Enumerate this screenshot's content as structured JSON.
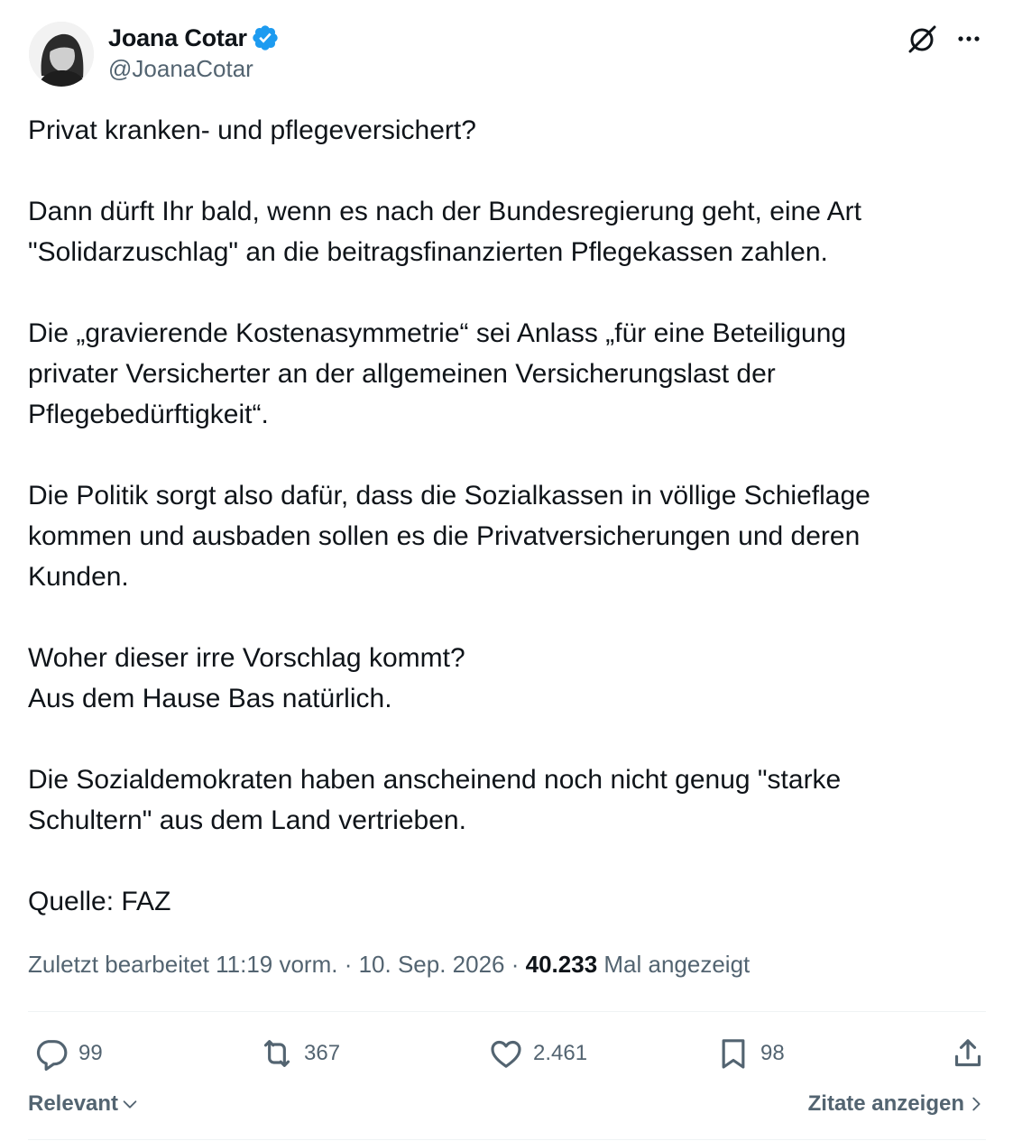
{
  "author": {
    "name": "Joana Cotar",
    "handle": "@JoanaCotar",
    "verified_color": "#1d9bf0"
  },
  "icons": {
    "grok": "grok-icon",
    "more": "more-icon"
  },
  "paragraphs": [
    "Privat kranken- und pflegeversichert?",
    "Dann dürft Ihr bald, wenn es nach der Bundesregierung geht, eine Art\n\"Solidarzuschlag\" an die beitragsfinanzierten Pflegekassen zahlen.",
    "Die „gravierende Kostenasymmetrie“ sei Anlass „für eine Beteiligung\nprivater Versicherter an der allgemeinen Versicherungslast der\nPflegebedürftigkeit“.",
    "Die Politik sorgt also dafür, dass die Sozialkassen in völlige Schieflage\nkommen und ausbaden sollen es die Privatversicherungen und deren\nKunden.",
    "Woher dieser irre Vorschlag kommt?\nAus dem Hause Bas natürlich.",
    "Die Sozialdemokraten haben anscheinend noch nicht genug \"starke\nSchultern\" aus dem Land vertrieben.",
    "Quelle: FAZ"
  ],
  "meta": {
    "edited": "Zuletzt bearbeitet 11:19 vorm.",
    "separator": " · ",
    "date": "10. Sep. 2026",
    "views_count": "40.233",
    "views_label": "Mal angezeigt"
  },
  "actions": {
    "replies": "99",
    "reposts": "367",
    "likes": "2.461",
    "bookmarks": "98"
  },
  "footer": {
    "sort_label": "Relevant",
    "quotes_label": "Zitate anzeigen"
  }
}
